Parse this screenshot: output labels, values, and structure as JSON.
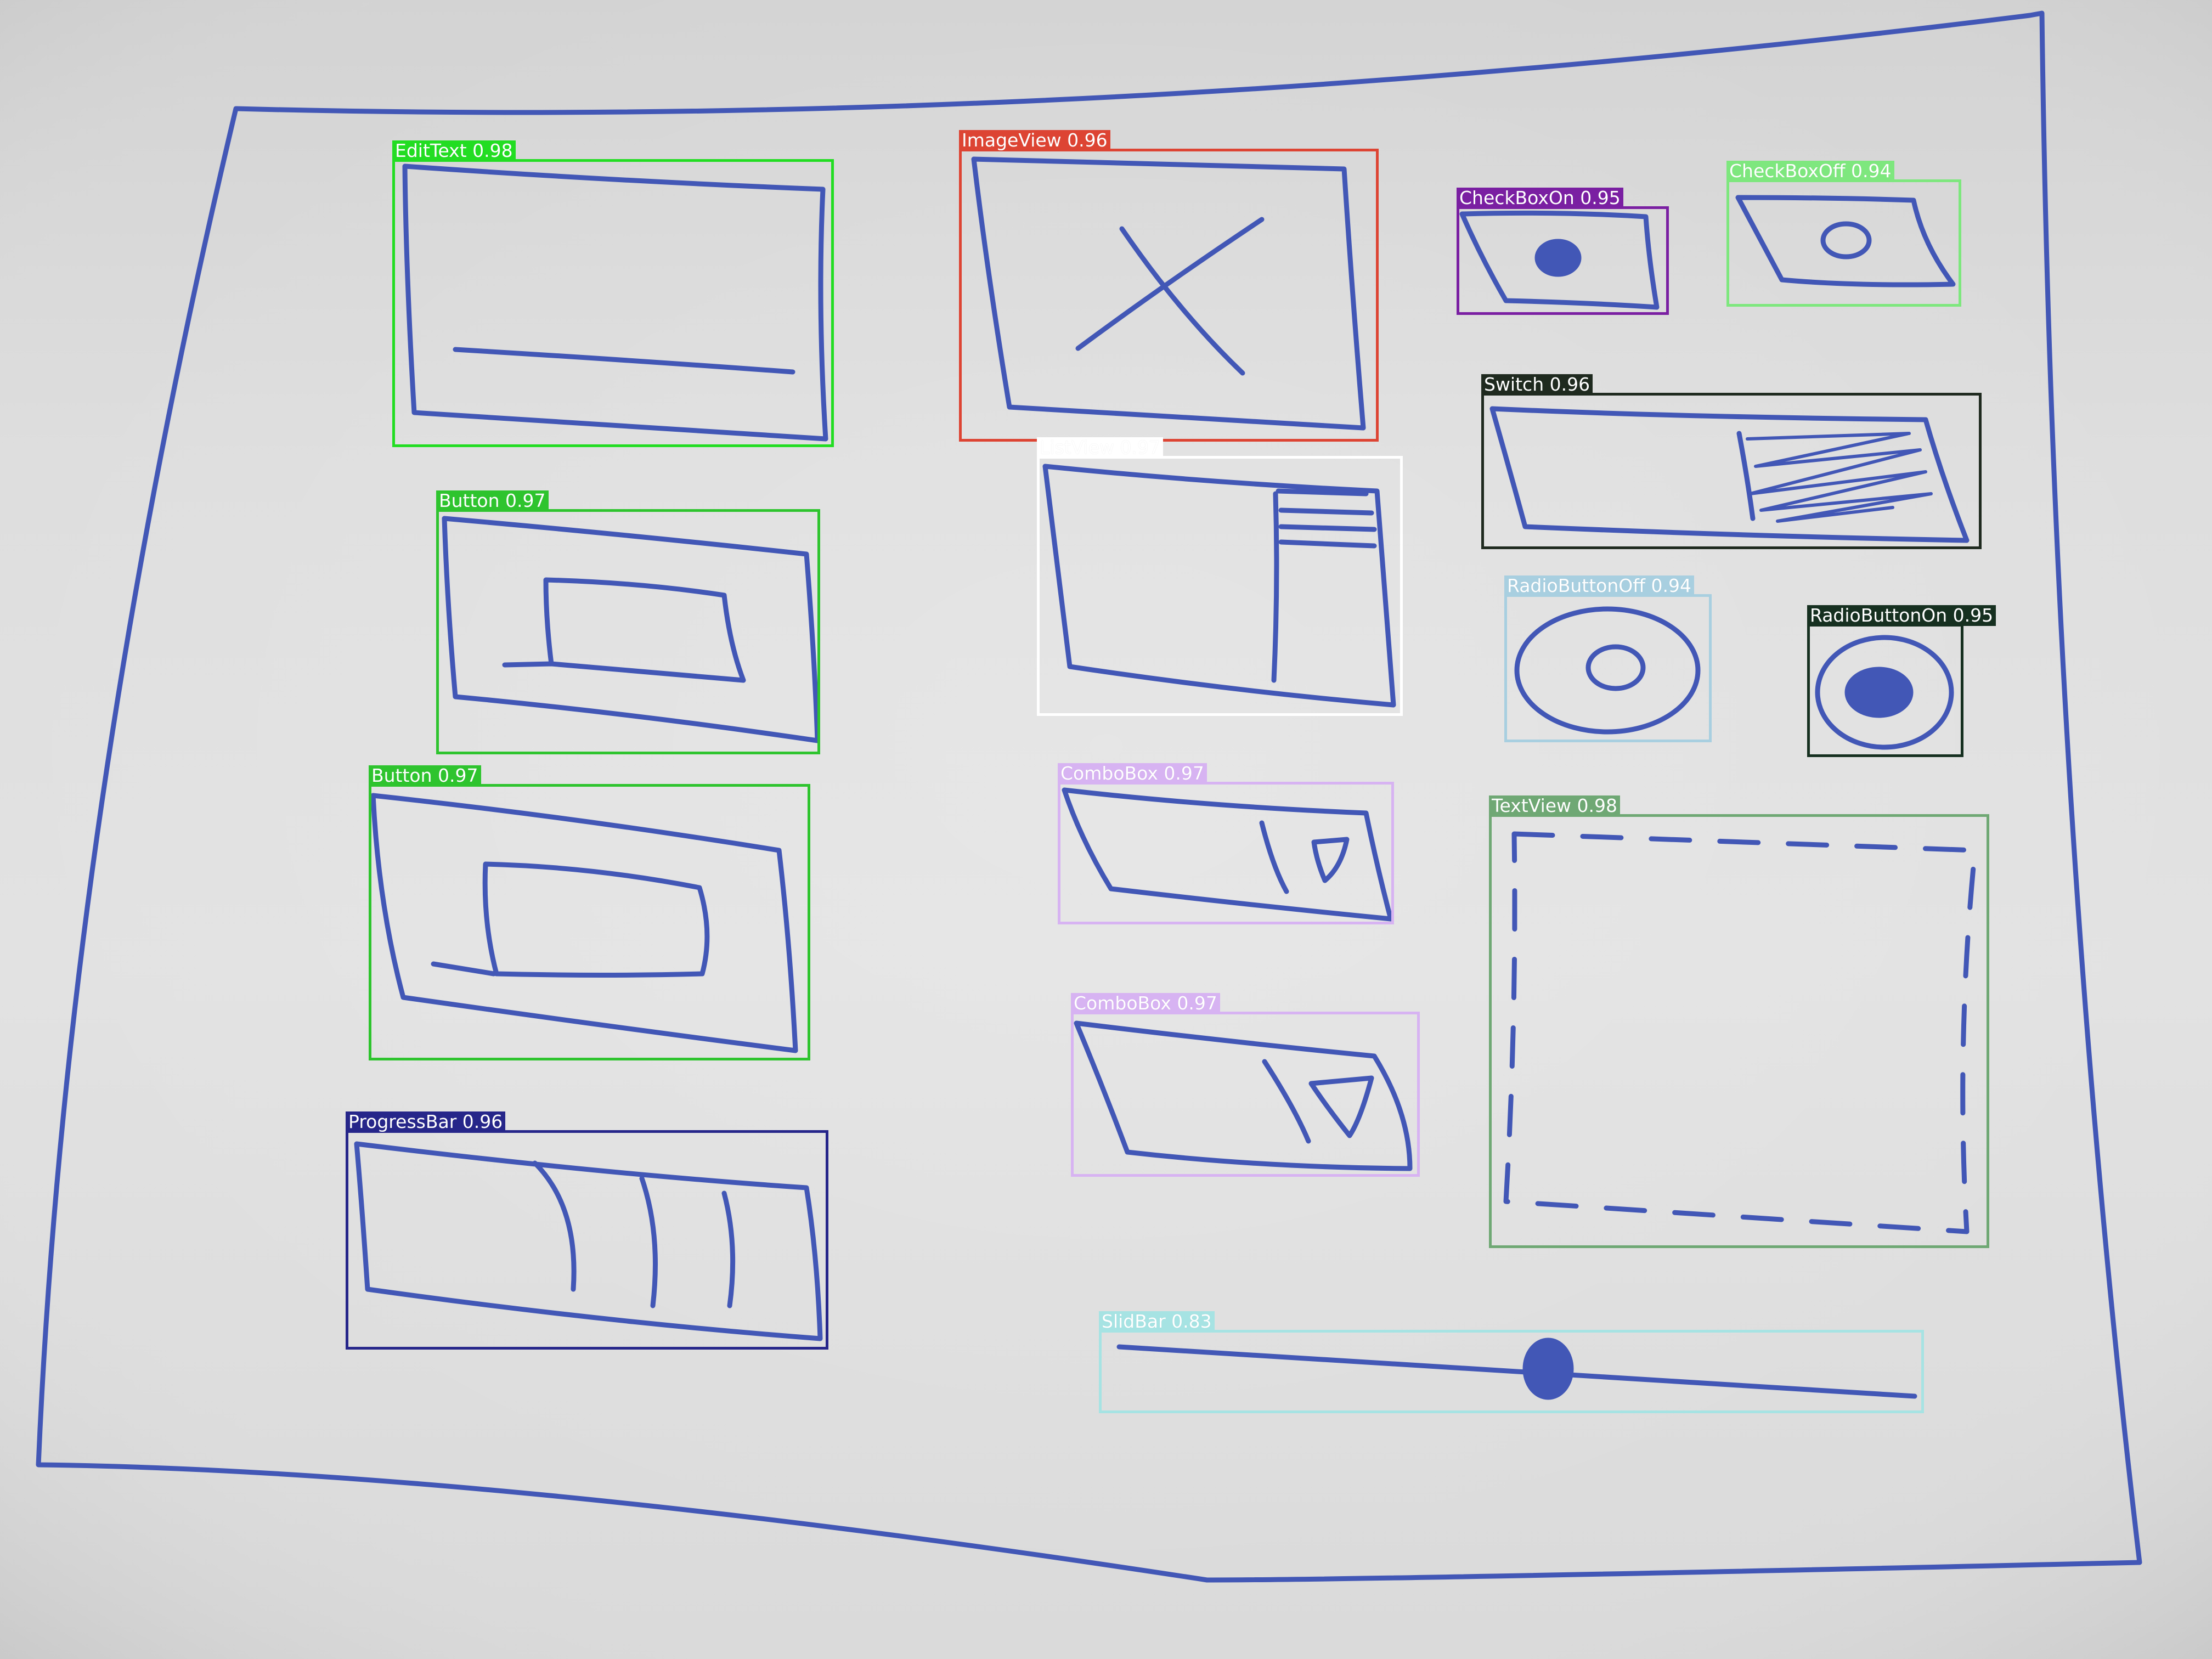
{
  "image": {
    "type": "photo of a hand-drawn UI wireframe sketch with object-detection overlays"
  },
  "colors": {
    "paper": "#dedede",
    "ink": "#3f55b8",
    "edittext": "#22dd22",
    "imageview": "#dd4433",
    "checkboxon": "#7a1fa2",
    "checkboxoff": "#7ee77e",
    "switch": "#1f2a1f",
    "listview": "#ffffff",
    "button": "#2ec42e",
    "radiobuttonoff": "#a8cfe0",
    "radiobuttonon": "#163020",
    "combobox": "#d7b3f2",
    "textview": "#6fa874",
    "progressbar": "#26268a",
    "slidbar": "#a6e3e3"
  },
  "detections": [
    {
      "id": "edittext",
      "label": "EditText 0.98",
      "class": "EditText",
      "score": 0.98,
      "color": "edittext"
    },
    {
      "id": "imageview",
      "label": "ImageView 0.96",
      "class": "ImageView",
      "score": 0.96,
      "color": "imageview"
    },
    {
      "id": "checkboxon",
      "label": "CheckBoxOn 0.95",
      "class": "CheckBoxOn",
      "score": 0.95,
      "color": "checkboxon"
    },
    {
      "id": "checkboxoff",
      "label": "CheckBoxOff 0.94",
      "class": "CheckBoxOff",
      "score": 0.94,
      "color": "checkboxoff"
    },
    {
      "id": "switch",
      "label": "Switch 0.96",
      "class": "Switch",
      "score": 0.96,
      "color": "switch"
    },
    {
      "id": "listview",
      "label": "ListView 0.97",
      "class": "ListView",
      "score": 0.97,
      "color": "listview"
    },
    {
      "id": "button-1",
      "label": "Button 0.97",
      "class": "Button",
      "score": 0.97,
      "color": "button"
    },
    {
      "id": "button-2",
      "label": "Button 0.97",
      "class": "Button",
      "score": 0.97,
      "color": "button"
    },
    {
      "id": "radiobuttonoff",
      "label": "RadioButtonOff 0.94",
      "class": "RadioButtonOff",
      "score": 0.94,
      "color": "radiobuttonoff"
    },
    {
      "id": "radiobuttonon",
      "label": "RadioButtonOn 0.95",
      "class": "RadioButtonOn",
      "score": 0.95,
      "color": "radiobuttonon"
    },
    {
      "id": "combobox-1",
      "label": "ComboBox 0.97",
      "class": "ComboBox",
      "score": 0.97,
      "color": "combobox"
    },
    {
      "id": "combobox-2",
      "label": "ComboBox 0.97",
      "class": "ComboBox",
      "score": 0.97,
      "color": "combobox"
    },
    {
      "id": "textview",
      "label": "TextView 0.98",
      "class": "TextView",
      "score": 0.98,
      "color": "textview"
    },
    {
      "id": "progressbar",
      "label": "ProgressBar 0.96",
      "class": "ProgressBar",
      "score": 0.96,
      "color": "progressbar"
    },
    {
      "id": "slidbar",
      "label": "SlidBar 0.83",
      "class": "SlidBar",
      "score": 0.83,
      "color": "slidbar"
    }
  ]
}
